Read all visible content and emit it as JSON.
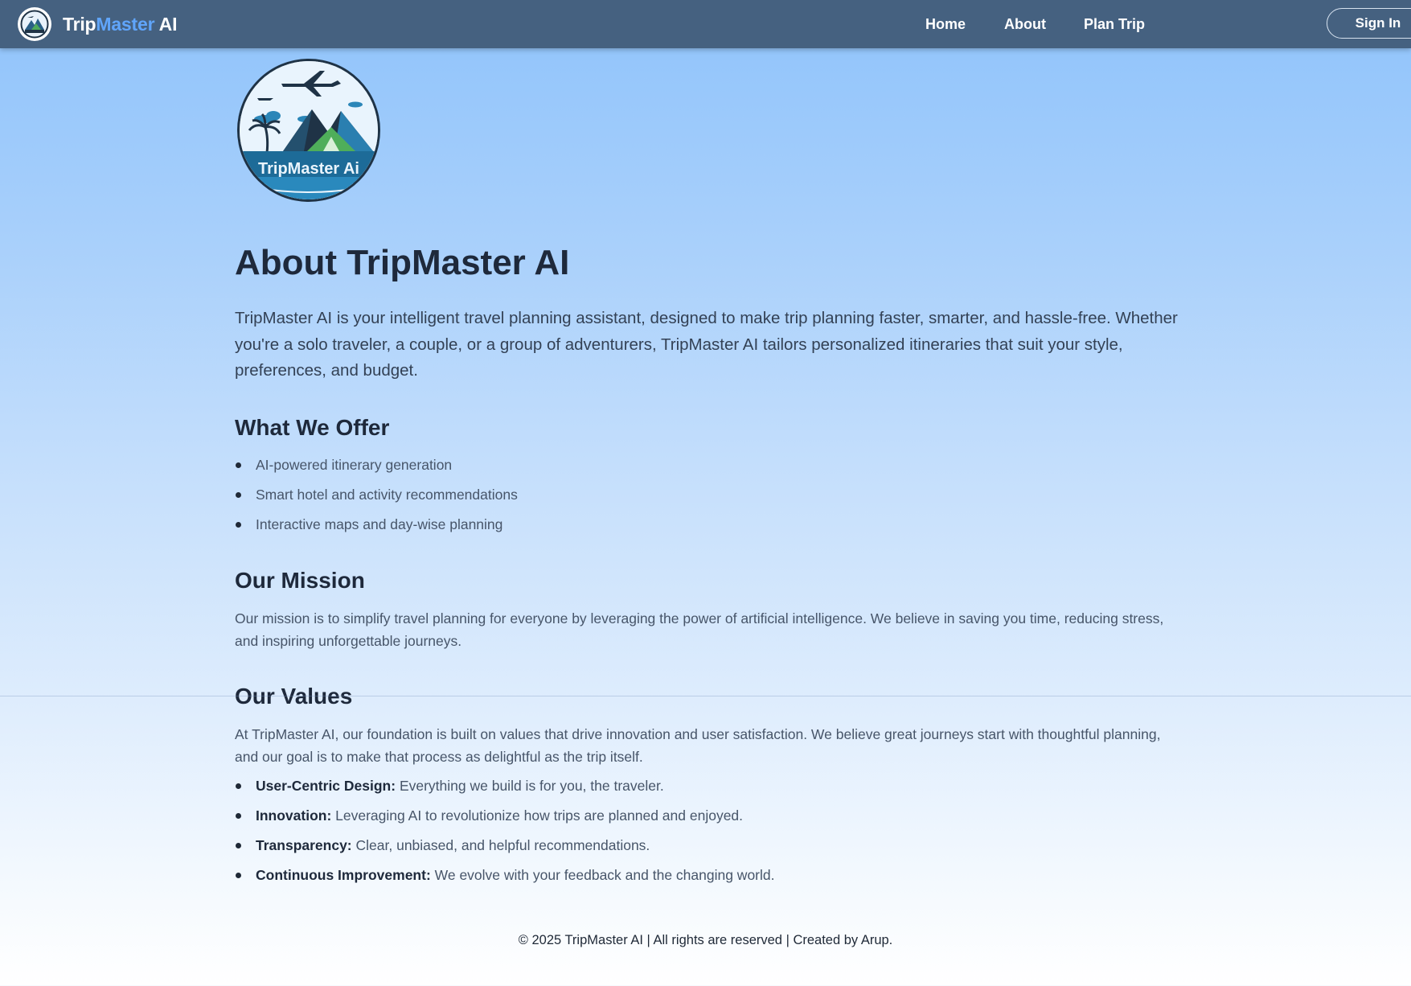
{
  "nav": {
    "brand": {
      "part1": "Trip",
      "part2": "Master",
      "part3": "AI"
    },
    "links": [
      "Home",
      "About",
      "Plan Trip"
    ],
    "signin_label": "Sign In"
  },
  "hero": {
    "logo_text": "TripMaster Ai"
  },
  "page": {
    "title": "About TripMaster AI",
    "intro": "TripMaster AI is your intelligent travel planning assistant, designed to make trip planning faster, smarter, and hassle-free. Whether you're a solo traveler, a couple, or a group of adventurers, TripMaster AI tailors personalized itineraries that suit your style, preferences, and budget."
  },
  "offer": {
    "heading": "What We Offer",
    "items": [
      "AI-powered itinerary generation",
      "Smart hotel and activity recommendations",
      "Interactive maps and day-wise planning"
    ]
  },
  "mission": {
    "heading": "Our Mission",
    "text": "Our mission is to simplify travel planning for everyone by leveraging the power of artificial intelligence. We believe in saving you time, reducing stress, and inspiring unforgettable journeys."
  },
  "values": {
    "heading": "Our Values",
    "text": "At TripMaster AI, our foundation is built on values that drive innovation and user satisfaction. We believe great journeys start with thoughtful planning, and our goal is to make that process as delightful as the trip itself.",
    "items": [
      {
        "term": "User-Centric Design:",
        "desc": " Everything we build is for you, the traveler."
      },
      {
        "term": "Innovation:",
        "desc": " Leveraging AI to revolutionize how trips are planned and enjoyed."
      },
      {
        "term": "Transparency:",
        "desc": " Clear, unbiased, and helpful recommendations."
      },
      {
        "term": "Continuous Improvement:",
        "desc": " We evolve with your feedback and the changing world."
      }
    ]
  },
  "footer": {
    "text": "© 2025 TripMaster AI | All rights are reserved | Created by Arup."
  },
  "colors": {
    "navbar": "#456180",
    "brand_accent": "#60a5fa",
    "heading": "#1e293b",
    "body_text": "#475569",
    "logo_ring": "#1f3346"
  },
  "icons": {
    "brand_logo": "tripmaster-logo-icon",
    "list_bullet": "bullet-dot"
  }
}
